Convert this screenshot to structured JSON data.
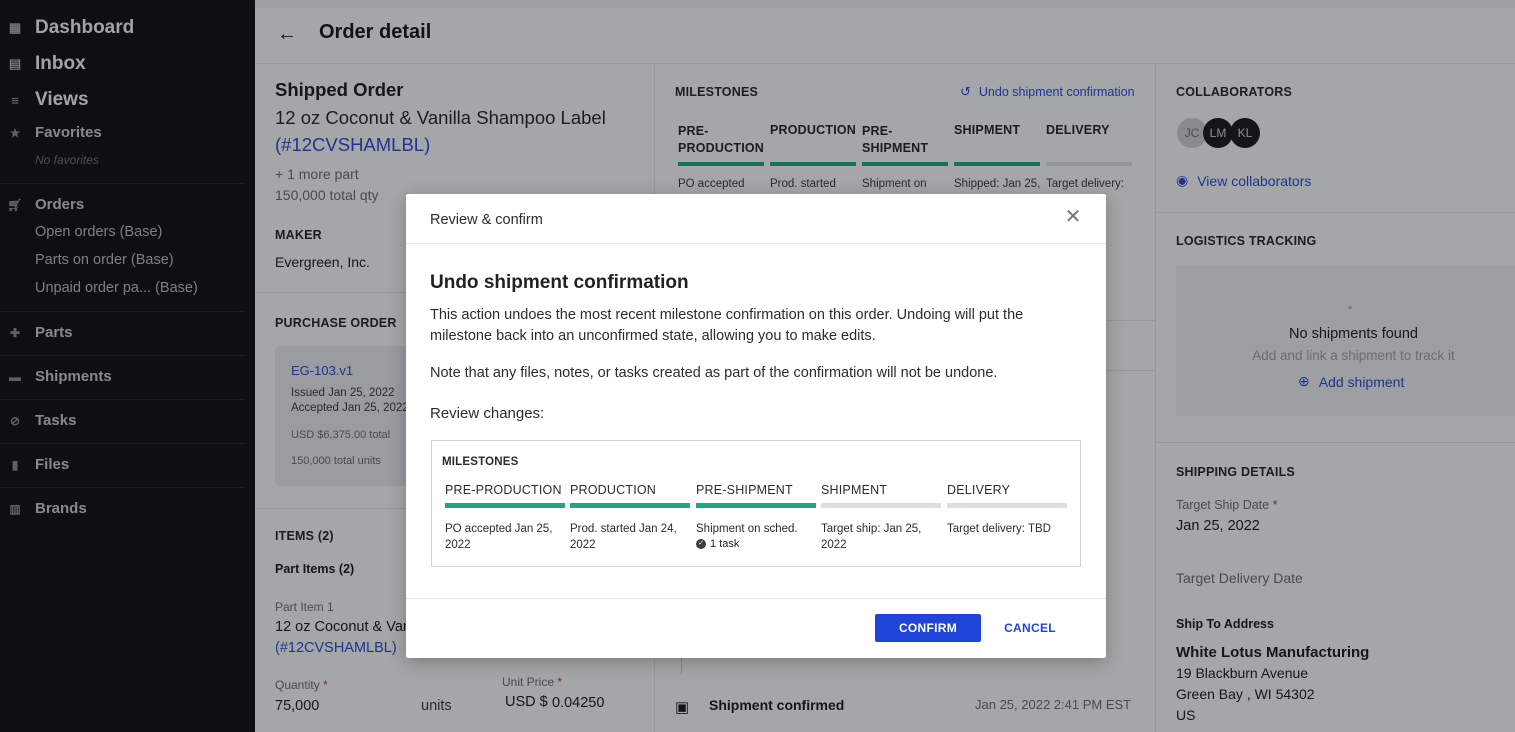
{
  "sidebar": {
    "dashboard": "Dashboard",
    "inbox": "Inbox",
    "views": "Views",
    "favorites": "Favorites",
    "no_favorites": "No favorites",
    "orders": "Orders",
    "order_views": [
      "Open orders (Base)",
      "Parts on order (Base)",
      "Unpaid order pa... (Base)"
    ],
    "parts": "Parts",
    "shipments": "Shipments",
    "tasks": "Tasks",
    "files": "Files",
    "brands": "Brands"
  },
  "header": {
    "title": "Order detail"
  },
  "order": {
    "status": "Shipped Order",
    "name": "12 oz Coconut & Vanilla Shampoo Label",
    "code": "(#12CVSHAMLBL)",
    "more_parts": "+ 1 more part",
    "total_qty": "150,000 total qty",
    "maker_label": "MAKER",
    "maker": "Evergreen, Inc.",
    "po_label": "PURCHASE ORDER",
    "po": {
      "id": "EG-103.v1",
      "issued": "Issued Jan 25, 2022",
      "accepted": "Accepted Jan 25, 2022",
      "total": "USD $6,375.00 total",
      "units": "150,000 total units"
    },
    "items_label": "ITEMS (2)",
    "part_items_label": "Part Items (2)",
    "part_item_label": "Part Item 1",
    "part_item_name": "12 oz Coconut & Vanilla Shampoo Label",
    "part_item_code": "(#12CVSHAMLBL)",
    "quantity_label": "Quantity",
    "quantity": "75,000",
    "units": "units",
    "unit_price_label": "Unit Price",
    "currency": "USD $",
    "unit_price": "0.04250"
  },
  "milestones": {
    "label": "MILESTONES",
    "undo_link": "Undo shipment confirmation",
    "steps": [
      {
        "name": "PRE-\nPRODUCTION",
        "desc": "PO accepted"
      },
      {
        "name": "PRODUCTION",
        "desc": "Prod. started"
      },
      {
        "name": "PRE-\nSHIPMENT",
        "desc": "Shipment on"
      },
      {
        "name": "SHIPMENT",
        "desc": "Shipped: Jan 25,"
      },
      {
        "name": "DELIVERY",
        "desc": "Target delivery:"
      }
    ],
    "activity": {
      "title": "Shipment confirmed",
      "time": "Jan 25, 2022 2:41 PM EST"
    }
  },
  "right": {
    "collaborators_label": "COLLABORATORS",
    "avatars": [
      "JC",
      "LM",
      "KL"
    ],
    "view_collaborators": "View collaborators",
    "logistics_label": "LOGISTICS TRACKING",
    "no_shipments": "No shipments found",
    "no_shipments_sub": "Add and link a shipment to track it",
    "add_shipment": "Add shipment",
    "shipping_label": "SHIPPING DETAILS",
    "target_ship_label": "Target Ship Date",
    "target_ship": "Jan 25, 2022",
    "target_delivery_label": "Target Delivery Date",
    "ship_to_label": "Ship To Address",
    "ship_to_name": "White Lotus Manufacturing",
    "ship_to_line1": "19 Blackburn Avenue",
    "ship_to_line2": "Green Bay , WI 54302",
    "ship_to_country": "US"
  },
  "modal": {
    "header": "Review & confirm",
    "title": "Undo shipment confirmation",
    "body1": "This action undoes the most recent milestone confirmation on this order. Undoing will put the milestone back into an unconfirmed state, allowing you to make edits.",
    "body2": "Note that any files, notes, or tasks created as part of the confirmation will not be undone.",
    "review_label": "Review changes:",
    "box_label": "MILESTONES",
    "steps": [
      {
        "name": "PRE-PRODUCTION",
        "desc": "PO accepted Jan 25, 2022",
        "task": ""
      },
      {
        "name": "PRODUCTION",
        "desc": "Prod. started Jan 24, 2022",
        "task": ""
      },
      {
        "name": "PRE-SHIPMENT",
        "desc": "Shipment on sched.",
        "task": "1 task"
      },
      {
        "name": "SHIPMENT",
        "desc": "Target ship: Jan 25, 2022",
        "task": ""
      },
      {
        "name": "DELIVERY",
        "desc": "Target delivery: TBD",
        "task": ""
      }
    ],
    "confirm": "CONFIRM",
    "cancel": "CANCEL"
  },
  "colors": {
    "accent": "#1f45d6",
    "milestone_done": "#1fa783",
    "milestone_pending": "#dcdee2",
    "sidebar": "#15171c"
  }
}
